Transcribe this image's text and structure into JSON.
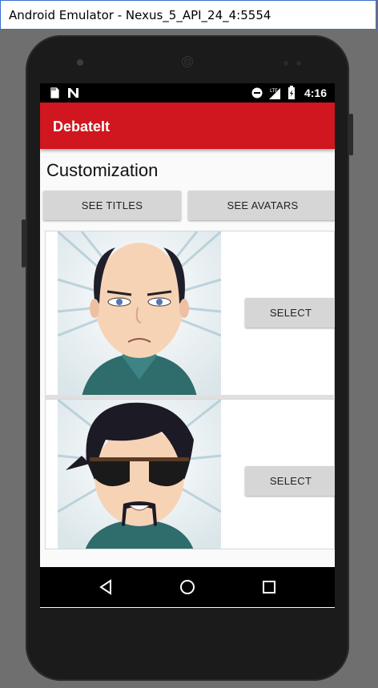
{
  "window": {
    "title": "Android Emulator - Nexus_5_API_24_4:5554"
  },
  "status_bar": {
    "time": "4:16",
    "network": "LTE",
    "icons": [
      "sd-card-icon",
      "n-logo-icon",
      "do-not-disturb-icon",
      "lte-signal-icon",
      "battery-charging-icon"
    ]
  },
  "app_bar": {
    "title": "DebateIt"
  },
  "page": {
    "heading": "Customization"
  },
  "tabs": [
    {
      "label": "SEE TITLES"
    },
    {
      "label": "SEE AVATARS"
    }
  ],
  "avatars": [
    {
      "name": "bald-man-avatar",
      "select_label": "SELECT"
    },
    {
      "name": "sunglasses-man-avatar",
      "select_label": "SELECT"
    }
  ],
  "nav": {
    "back": "back-icon",
    "home": "home-icon",
    "recents": "recents-icon"
  },
  "colors": {
    "accent": "#d0161e",
    "button_bg": "#d6d6d6",
    "screen_bg": "#fafafa"
  }
}
